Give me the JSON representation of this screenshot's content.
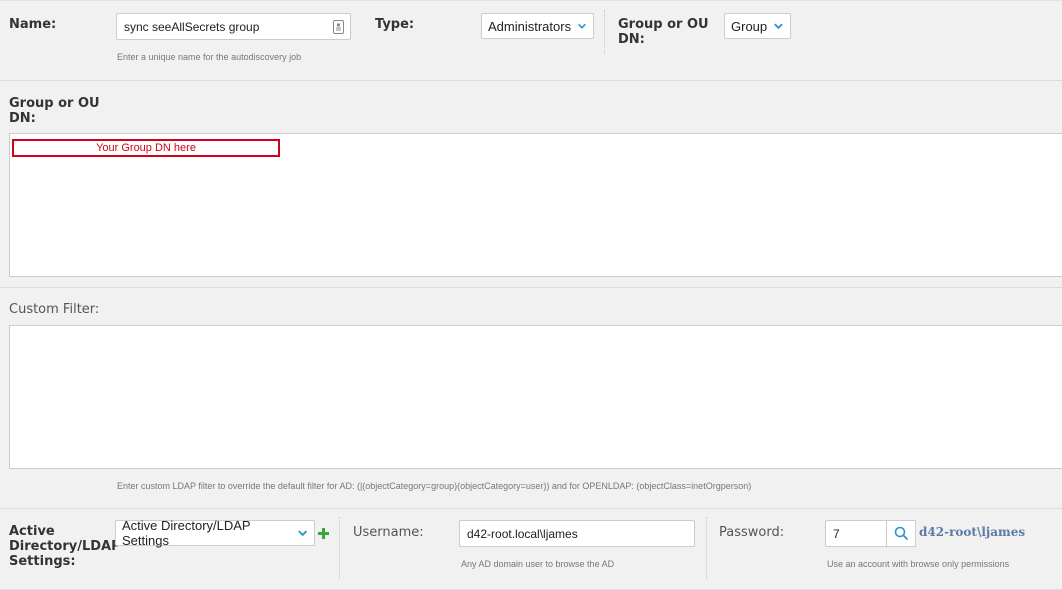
{
  "row1": {
    "name_label": "Name:",
    "name_value": "sync seeAllSecrets group",
    "name_help": "Enter a unique name for the autodiscovery job",
    "type_label": "Type:",
    "type_value": "Administrators",
    "group_ou_label_line1": "Group or OU",
    "group_ou_label_line2": "DN:",
    "group_ou_value": "Group"
  },
  "group_dn": {
    "label_line1": "Group or OU",
    "label_line2": "DN:",
    "annotation_text": "Your Group DN here"
  },
  "custom_filter": {
    "label": "Custom Filter:",
    "help": "Enter custom LDAP filter to override the default filter for AD: (|(objectCategory=group)(objectCategory=user)) and for OPENLDAP: (objectClass=inetOrgperson)"
  },
  "ad_settings": {
    "label_line1": "Active",
    "label_line2": "Directory/LDAP",
    "label_line3": "Settings:",
    "select_value": "Active Directory/LDAP Settings",
    "username_label": "Username:",
    "username_value": "d42-root.local\\ljames",
    "username_help": "Any AD domain user to browse the AD",
    "password_label": "Password:",
    "password_value": "7",
    "password_display": "d42-root\\ljames",
    "password_help": "Use an account with browse only permissions"
  },
  "colors": {
    "accent": "#2a95c8",
    "annotation_red": "#d0021b",
    "add_green": "#3aa63a",
    "link_blue": "#5a7aa8"
  }
}
